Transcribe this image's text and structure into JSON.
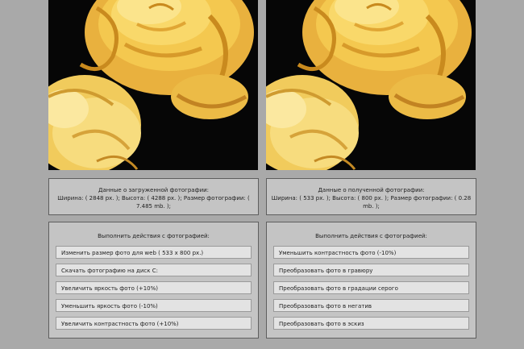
{
  "left": {
    "info": {
      "title": "Данные о загруженной фотографии:",
      "details": "Ширина: ( 2848 px. ); Высота: ( 4288 px. ); Размер фотографии: ( 7.485 mb. );"
    },
    "actions_title": "Выполнить действия с фотографией:",
    "buttons": [
      "Изменить размер фото для web ( 533 x 800 px.)",
      "Скачать фотографию на диск С:",
      "Увеличить яркость фото (+10%)",
      "Уменьшить яркость фото (-10%)",
      "Увеличить контрастность фото (+10%)"
    ]
  },
  "right": {
    "info": {
      "title": "Данные о полученной фотографии:",
      "details": "Ширина: ( 533 px. ); Высота: ( 800 px. ); Размер фотографии: ( 0.28 mb. );"
    },
    "actions_title": "Выполнить действия с фотографией:",
    "buttons": [
      "Уменьшить контрастность фото (-10%)",
      "Преобразовать фото в гравюру",
      "Преобразовать фото в градации серого",
      "Преобразовать фото в негатив",
      "Преобразовать фото в эскиз"
    ]
  },
  "colors": {
    "background": "#a9a9a9",
    "panel": "#c4c4c4",
    "button": "#e3e3e3",
    "rose_petal": "#f2c24a",
    "rose_highlight": "#fbe690",
    "rose_shadow": "#c98a1e"
  }
}
